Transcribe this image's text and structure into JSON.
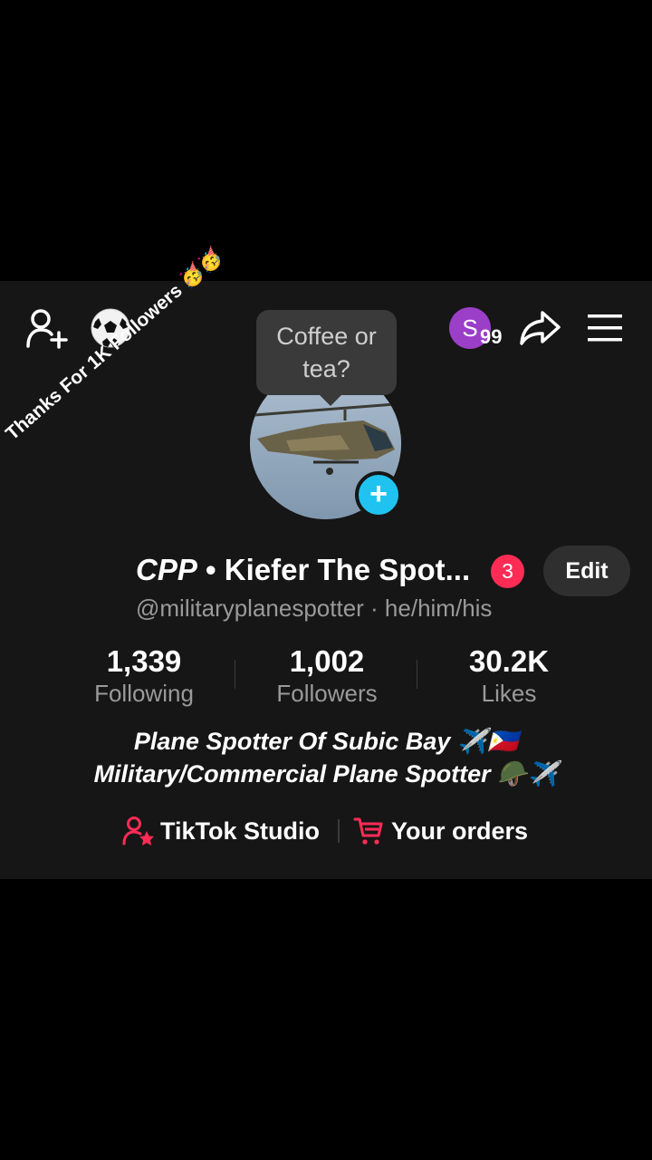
{
  "profile": {
    "name_prefix": "CPP",
    "name_rest": " • Kiefer The Spot...",
    "notification_count": "3",
    "edit_label": "Edit",
    "handle": "@militaryplanespotter · he/him/his",
    "bubble_text_line1": "Coffee or",
    "bubble_text_line2": "tea?",
    "banner_text": "Thanks For 1K Followers 🥳🥳"
  },
  "header": {
    "friend_badge_letter": "S",
    "friend_badge_count": "99"
  },
  "stats": [
    {
      "value": "1,339",
      "label": "Following"
    },
    {
      "value": "1,002",
      "label": "Followers"
    },
    {
      "value": "30.2K",
      "label": "Likes"
    }
  ],
  "bio": {
    "line1": "Plane Spotter Of Subic Bay ✈️🇵🇭",
    "line2": "Military/Commercial Plane Spotter 🪖✈️"
  },
  "links": {
    "studio_label": "TikTok Studio",
    "orders_label": "Your orders"
  },
  "colors": {
    "accent_red": "#fe2c55",
    "accent_blue": "#20c3f0",
    "friend_purple": "#9b3fc9"
  },
  "icons": {
    "add_friend": "add-friend-icon",
    "soccer": "soccer-ball-icon",
    "share": "share-icon",
    "menu": "hamburger-menu-icon",
    "studio": "studio-icon",
    "cart": "cart-icon"
  }
}
